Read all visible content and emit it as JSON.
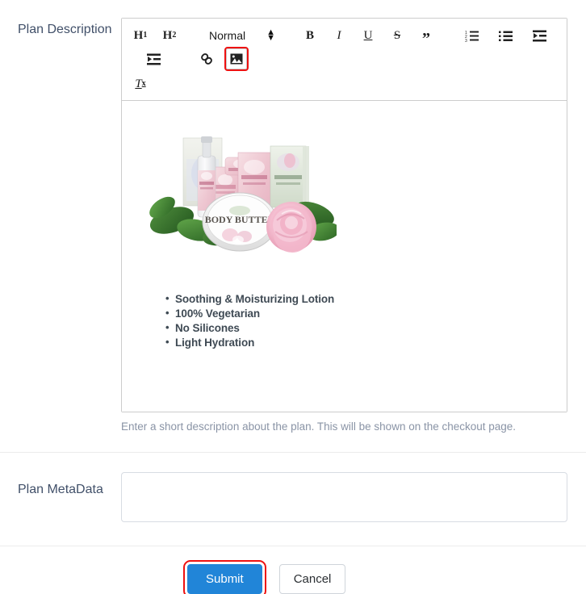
{
  "form": {
    "description_label": "Plan Description",
    "metadata_label": "Plan MetaData",
    "help_text": "Enter a short description about the plan. This will be shown on the checkout page.",
    "metadata_value": "",
    "metadata_placeholder": ""
  },
  "editor": {
    "toolbar": {
      "h1_label": "H",
      "h1_sub": "1",
      "h2_label": "H",
      "h2_sub": "2",
      "format_picker_value": "Normal",
      "bold_label": "B",
      "italic_label": "I",
      "underline_label": "U",
      "strike_label": "S",
      "quote_label": "”",
      "clear_format_label": "T",
      "clear_format_sub": "x",
      "items": [
        "heading-1-button",
        "heading-2-button",
        "format-picker",
        "bold-button",
        "italic-button",
        "underline-button",
        "strikethrough-button",
        "blockquote-button",
        "ordered-list-button",
        "bullet-list-button",
        "outdent-button",
        "indent-button",
        "link-button",
        "image-button",
        "clear-format-button"
      ]
    },
    "content": {
      "image_alt": "Rose cosmetics product set with leaves and pink rose",
      "bullets": [
        "Soothing & Moisturizing Lotion",
        "100% Vegetarian",
        "No Silicones",
        "Light Hydration"
      ]
    }
  },
  "buttons": {
    "submit_label": "Submit",
    "cancel_label": "Cancel"
  },
  "colors": {
    "submit_blue": "#2185d8",
    "highlight_red": "#ee1111",
    "label_text": "#415069",
    "help_text": "#8a94a6",
    "bullet_text": "#3f4a54",
    "border_gray": "#cccccc"
  }
}
